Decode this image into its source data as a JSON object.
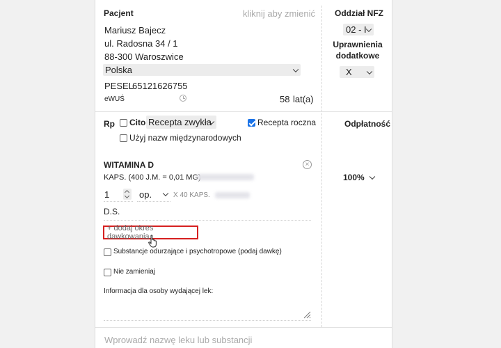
{
  "patient": {
    "heading": "Pacjent",
    "change_hint": "kliknij aby zmienić",
    "name": "Mariusz Bajecz",
    "street": "ul. Radosna 34 / 1",
    "city": "88-300 Waroszwice",
    "country": "Polska",
    "pesel_label": "PESEL",
    "pesel": "65121626755",
    "ewus_label": "eWUŚ",
    "age_value": "58",
    "age_unit": "lat(a)"
  },
  "nfz": {
    "heading": "Oddział NFZ",
    "branch_value": "02 - I",
    "extra_rights_heading": "Uprawnienia dodatkowe",
    "extra_rights_value": "X"
  },
  "prescription": {
    "rp_label": "Rp",
    "cito_label": "Cito",
    "cito_checked": false,
    "type_value": "Recepta zwykła",
    "annual_label": "Recepta roczna",
    "annual_checked": true,
    "intl_names_label": "Użyj nazw międzynarodowych",
    "intl_names_checked": false
  },
  "payment": {
    "heading": "Odpłatność",
    "value": "100%"
  },
  "drug": {
    "name": "WITAMINA D",
    "form": "KAPS. (400 J.M. = 0,01 MG)",
    "quantity": "1",
    "unit_value": "op.",
    "pack_info": "X 40 KAPS.",
    "ds_label": "D.S.",
    "add_dosing_label": "+ dodaj okres dawkowania",
    "narcotic_label": "Substancje odurzające i psychotropowe (podaj dawkę)",
    "narcotic_checked": false,
    "no_substitute_label": "Nie zamieniaj",
    "no_substitute_checked": false,
    "dispenser_info_label": "Informacja dla osoby wydającej lek:"
  },
  "search": {
    "placeholder": "Wprowadź nazwę leku lub substancji"
  }
}
